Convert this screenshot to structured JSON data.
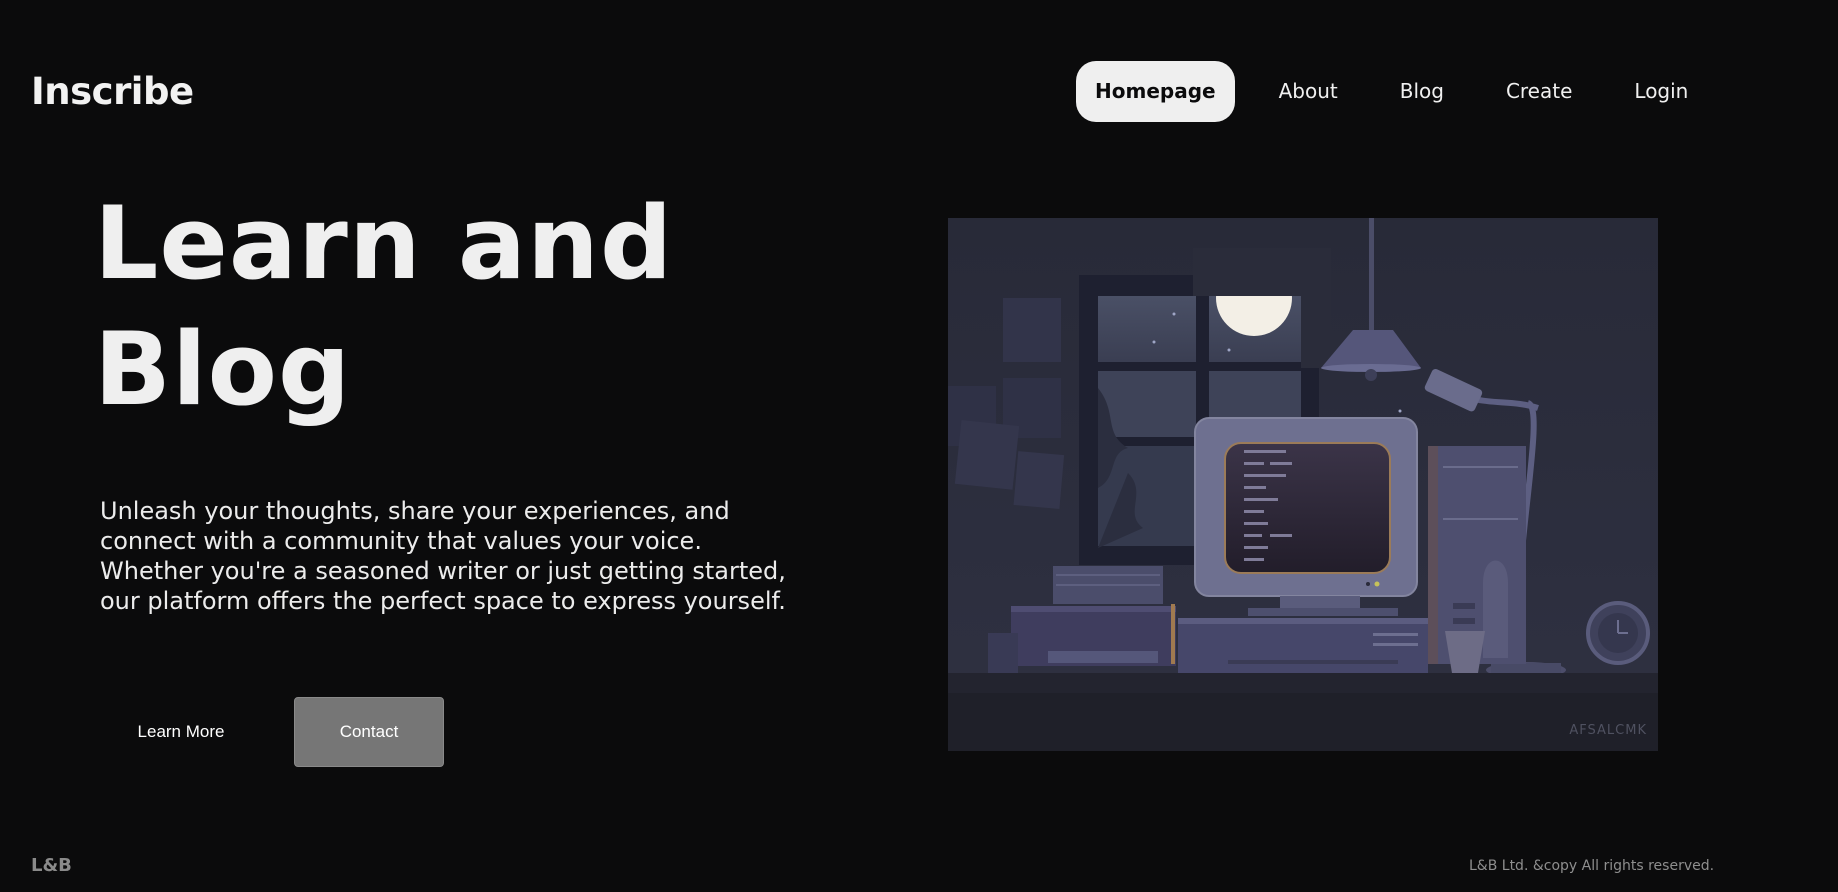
{
  "header": {
    "logo": "Inscribe",
    "nav": [
      {
        "label": "Homepage",
        "active": true
      },
      {
        "label": "About",
        "active": false
      },
      {
        "label": "Blog",
        "active": false
      },
      {
        "label": "Create",
        "active": false
      },
      {
        "label": "Login",
        "active": false
      }
    ]
  },
  "hero": {
    "title_line1": "Learn and",
    "title_line2": "Blog",
    "description": "Unleash your thoughts, share your experiences, and connect with a community that values your voice. Whether you're a seasoned writer or just getting started, our platform offers the perfect space to express yourself.",
    "learn_more_label": "Learn More",
    "contact_label": "Contact"
  },
  "illustration": {
    "watermark": "AFSALCMK",
    "icon": "retro-computer-desk-illustration"
  },
  "footer": {
    "logo": "L&B",
    "copyright": "L&B Ltd. &copy All rights reserved."
  },
  "colors": {
    "background": "#0b0b0c",
    "active_nav_bg": "#efefef",
    "contact_button_bg": "#767676",
    "illustration_bg": "#2a2c3a"
  }
}
